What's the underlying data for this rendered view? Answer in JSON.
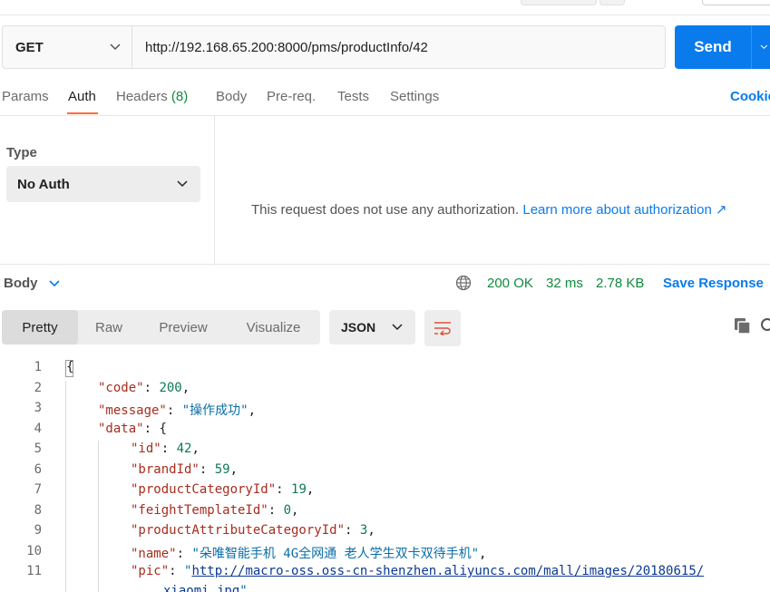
{
  "request": {
    "method": "GET",
    "url": "http://192.168.65.200:8000/pms/productInfo/42",
    "send_label": "Send"
  },
  "tabs": [
    {
      "label": "Params"
    },
    {
      "label": "Auth"
    },
    {
      "label": "Headers",
      "count": "(8)"
    },
    {
      "label": "Body"
    },
    {
      "label": "Pre-req."
    },
    {
      "label": "Tests"
    },
    {
      "label": "Settings"
    }
  ],
  "active_tab": "Auth",
  "cookies_label": "Cookie",
  "auth": {
    "type_label": "Type",
    "type_value": "No Auth",
    "message": "This request does not use any authorization.",
    "link": "Learn more about authorization ↗"
  },
  "response": {
    "body_label": "Body",
    "status": "200 OK",
    "time": "32 ms",
    "size": "2.78 KB",
    "save_label": "Save Response",
    "views": [
      "Pretty",
      "Raw",
      "Preview",
      "Visualize"
    ],
    "active_view": "Pretty",
    "format": "JSON"
  },
  "code_lines": [
    {
      "no": "1",
      "text": "{"
    },
    {
      "no": "2",
      "key": "\"code\"",
      "num": "200",
      "tail": ","
    },
    {
      "no": "3",
      "key": "\"message\"",
      "str": "\"操作成功\"",
      "tail": ","
    },
    {
      "no": "4",
      "key": "\"data\"",
      "tail": " {"
    },
    {
      "no": "5",
      "key": "\"id\"",
      "num": "42",
      "tail": ","
    },
    {
      "no": "6",
      "key": "\"brandId\"",
      "num": "59",
      "tail": ","
    },
    {
      "no": "7",
      "key": "\"productCategoryId\"",
      "num": "19",
      "tail": ","
    },
    {
      "no": "8",
      "key": "\"feightTemplateId\"",
      "num": "0",
      "tail": ","
    },
    {
      "no": "9",
      "key": "\"productAttributeCategoryId\"",
      "num": "3",
      "tail": ","
    },
    {
      "no": "10",
      "key": "\"name\"",
      "str": "\"朵唯智能手机 4G全网通 老人学生双卡双待手机\"",
      "tail": ","
    },
    {
      "no": "11",
      "key": "\"pic\"",
      "link": "http://macro-oss.oss-cn-shenzhen.aliyuncs.com/mall/images/20180615/",
      "link_cont": "xiaomi.jpg"
    }
  ],
  "colors": {
    "accent": "#ff6c37",
    "primary": "#097bed",
    "success": "#0f8a3c"
  }
}
